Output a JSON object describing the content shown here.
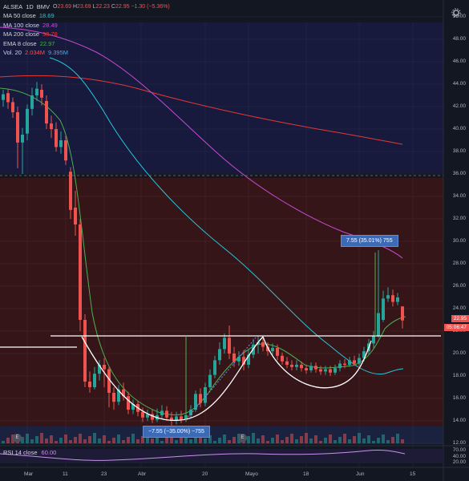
{
  "header": {
    "symbol": "ALSEA",
    "interval": "1D",
    "exchange": "BMV",
    "open_label": "O",
    "open": "23.69",
    "high_label": "H",
    "high": "23.69",
    "low_label": "L",
    "low": "22.23",
    "close_label": "C",
    "close": "22.95",
    "change": "−1.30 (−5.36%)"
  },
  "indicators": [
    {
      "label": "MA 50 close",
      "value": "18.69",
      "color": "#26c6da"
    },
    {
      "label": "MA 100 close",
      "value": "28.49",
      "color": "#c74bd3"
    },
    {
      "label": "MA 200 close",
      "value": "38.78",
      "color": "#e53935"
    },
    {
      "label": "EMA 8 close",
      "value": "22.97",
      "color": "#4caf50"
    }
  ],
  "volume": {
    "label": "Vol. 20",
    "value1": "2.034M",
    "value2": "9.395M",
    "color1": "#ef5350",
    "color2": "#29b6f6"
  },
  "rsi": {
    "label": "RSI 14 close",
    "value": "60.00",
    "color": "#c792ea"
  },
  "y_axis_ticks": [
    "50.00",
    "48.00",
    "46.00",
    "44.00",
    "42.00",
    "40.00",
    "38.00",
    "36.00",
    "34.00",
    "32.00",
    "30.00",
    "28.00",
    "26.00",
    "24.00",
    "22.00",
    "20.00",
    "18.00",
    "16.00",
    "14.00",
    "12.00"
  ],
  "rsi_ticks": [
    "70.00",
    "40.00",
    "20.00"
  ],
  "x_axis_ticks": [
    "Mar",
    "11",
    "23",
    "Abr",
    "20",
    "Mayo",
    "18",
    "Jun",
    "15"
  ],
  "price_tags": {
    "last_price": "22.95",
    "countdown": "05:06:47",
    "last_color": "#ef5350"
  },
  "annotations": {
    "rise": "7.55 (35.01%) 755",
    "fall": "−7.55 (−35.00%) −755"
  },
  "earnings_marker": "E",
  "colors": {
    "up": "#26a69a",
    "down": "#ef5350",
    "bg": "#131722",
    "zone_red": "#3a1418",
    "zone_blue": "#17193d",
    "neckline": "#ffffff"
  }
}
